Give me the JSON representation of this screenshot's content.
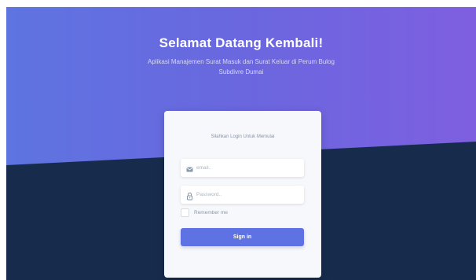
{
  "hero": {
    "title": "Selamat Datang Kembali!",
    "subtitle": "Aplikasi Manajemen Surat Masuk dan Surat Keluar di Perum Bulog Subdivre Dumai"
  },
  "login": {
    "prompt": "Silahkan Login Untuk Memulai",
    "email_placeholder": "email..",
    "email_value": "",
    "password_placeholder": "Password..",
    "password_value": "",
    "remember_label": "Remember me",
    "remember_checked": false,
    "submit_label": "Sign in"
  },
  "icons": {
    "email": "envelope-icon",
    "password": "lock-icon"
  },
  "colors": {
    "gradient_start": "#5e74e0",
    "gradient_end": "#7e5fe0",
    "background_dark": "#172b4d",
    "primary": "#5e72e4"
  }
}
